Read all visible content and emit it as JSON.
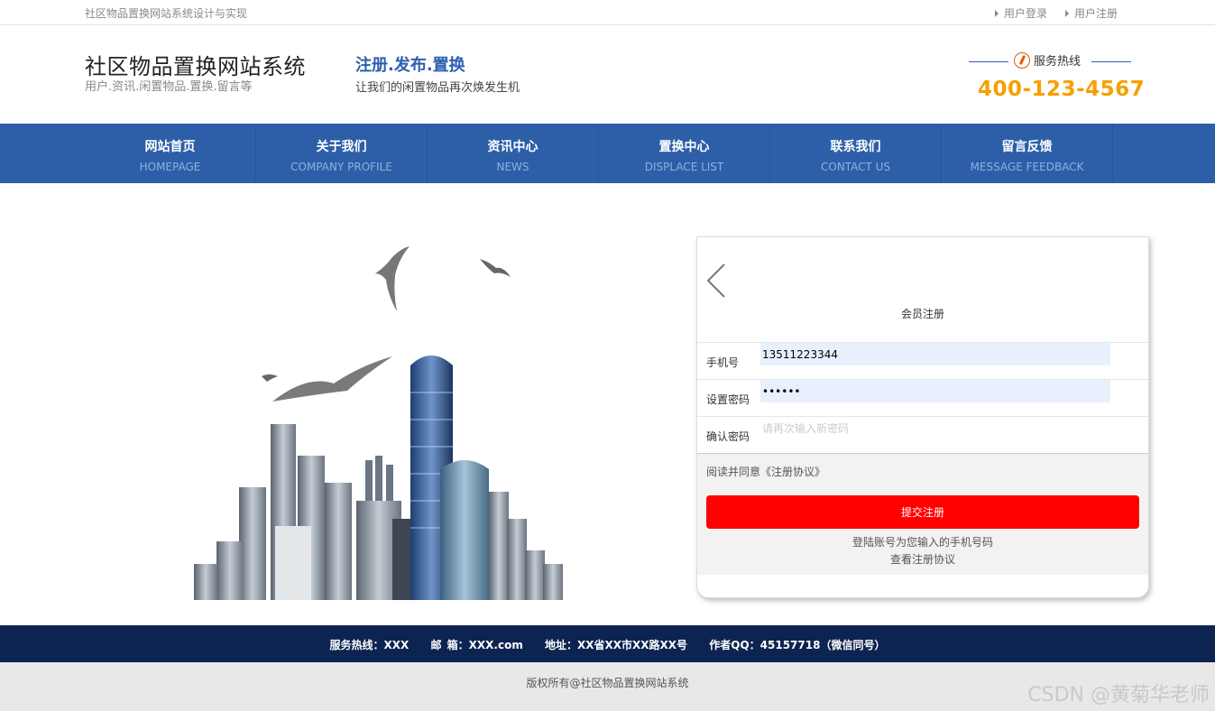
{
  "topbar": {
    "site_title": "社区物品置换网站系统设计与实现",
    "login_link": "用户登录",
    "register_link": "用户注册"
  },
  "header": {
    "logo_title": "社区物品置换网站系统",
    "logo_subtitle": "用户.资讯.闲置物品.置换.留言等",
    "slogan_title": "注册.发布.置换",
    "slogan_subtitle": "让我们的闲置物品再次焕发生机",
    "hotline_label": "服务热线",
    "hotline_number": "400-123-4567"
  },
  "nav": [
    {
      "cn": "网站首页",
      "en": "HOMEPAGE"
    },
    {
      "cn": "关于我们",
      "en": "COMPANY PROFILE"
    },
    {
      "cn": "资讯中心",
      "en": "NEWS"
    },
    {
      "cn": "置换中心",
      "en": "DISPLACE LIST"
    },
    {
      "cn": "联系我们",
      "en": "CONTACT US"
    },
    {
      "cn": "留言反馈",
      "en": "MESSAGE FEEDBACK"
    }
  ],
  "register": {
    "title": "会员注册",
    "phone_label": "手机号",
    "phone_value": "13511223344",
    "password_label": "设置密码",
    "password_value": "123456",
    "confirm_label": "确认密码",
    "confirm_placeholder": "请再次输入新密码",
    "agree_text": "阅读并同意《注册协议》",
    "submit_label": "提交注册",
    "hint_account": "登陆账号为您输入的手机号码",
    "hint_agreement": "查看注册协议"
  },
  "footer": {
    "hotline": "服务热线：XXX",
    "email": "邮 箱：XXX.com",
    "address": "地址：XX省XX市XX路XX号",
    "qq": "作者QQ：45157718（微信同号）",
    "copyright": "版权所有@社区物品置换网站系统"
  },
  "watermark": "CSDN @黄菊华老师",
  "colors": {
    "nav_bg": "#2d5fa8",
    "accent_blue": "#2c5fb0",
    "phone_orange": "#f5a000",
    "submit_red": "#ff0000",
    "footer_bg": "#0d2452"
  }
}
